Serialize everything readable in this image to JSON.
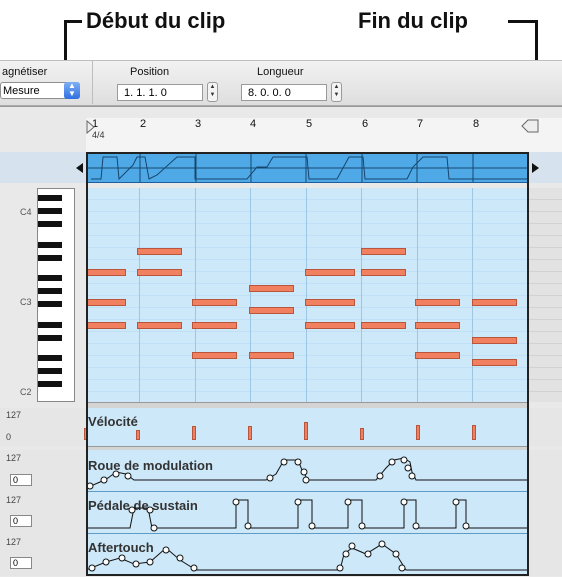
{
  "callouts": {
    "start": "Début du clip",
    "end": "Fin du clip"
  },
  "toolbar": {
    "quantize_label": "agnétiser",
    "quantize_value": "Mesure",
    "position_label": "Position",
    "position_value": "1. 1. 1.  0",
    "length_label": "Longueur",
    "length_value": "8. 0. 0.  0"
  },
  "ruler": {
    "timesig": "4/4",
    "bars": [
      "1",
      "2",
      "3",
      "4",
      "5",
      "6",
      "7",
      "8"
    ]
  },
  "keyboard": {
    "labels": [
      "C4",
      "C3",
      "C2"
    ]
  },
  "lanes": {
    "velocity": {
      "title": "Vélocité",
      "max": "127",
      "min": "0"
    },
    "modwheel": {
      "title": "Roue de modulation",
      "max": "127",
      "value": "0"
    },
    "sustain": {
      "title": "Pédale de sustain",
      "max": "127",
      "value": "0"
    },
    "aftertouch": {
      "title": "Aftertouch",
      "max": "127",
      "value": "0"
    }
  },
  "colors": {
    "clip_strip": "#4fa9e6",
    "note": "#f08060",
    "roll_bg": "#cde8f9"
  }
}
